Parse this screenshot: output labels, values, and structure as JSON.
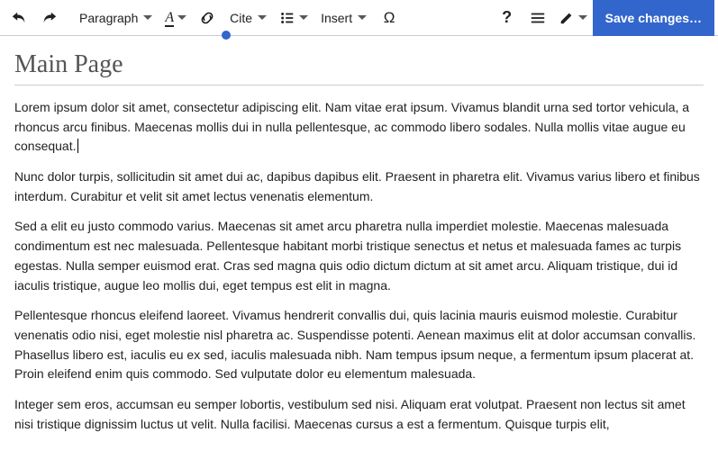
{
  "toolbar": {
    "format_dropdown_label": "Paragraph",
    "cite_label": "Cite",
    "insert_label": "Insert",
    "special_char_label": "Ω",
    "save_label": "Save changes…"
  },
  "page": {
    "title": "Main Page",
    "paragraphs": [
      "Lorem ipsum dolor sit amet, consectetur adipiscing elit. Nam vitae erat ipsum. Vivamus blandit urna sed tortor vehicula, a rhoncus arcu finibus. Maecenas mollis dui in nulla pellentesque, ac commodo libero sodales. Nulla mollis vitae augue eu consequat.",
      "Nunc dolor turpis, sollicitudin sit amet dui ac, dapibus dapibus elit. Praesent in pharetra elit. Vivamus varius libero et finibus interdum. Curabitur et velit sit amet lectus venenatis elementum.",
      "Sed a elit eu justo commodo varius. Maecenas sit amet arcu pharetra nulla imperdiet molestie. Maecenas malesuada condimentum est nec malesuada. Pellentesque habitant morbi tristique senectus et netus et malesuada fames ac turpis egestas. Nulla semper euismod erat. Cras sed magna quis odio dictum dictum at sit amet arcu. Aliquam tristique, dui id iaculis tristique, augue leo mollis dui, eget tempus est elit in magna.",
      "Pellentesque rhoncus eleifend laoreet. Vivamus hendrerit convallis dui, quis lacinia mauris euismod molestie. Curabitur venenatis odio nisi, eget molestie nisl pharetra ac. Suspendisse potenti. Aenean maximus elit at dolor accumsan convallis. Phasellus libero est, iaculis eu ex sed, iaculis malesuada nibh. Nam tempus ipsum neque, a fermentum ipsum placerat at. Proin eleifend enim quis commodo. Sed vulputate dolor eu elementum malesuada.",
      "Integer sem eros, accumsan eu semper lobortis, vestibulum sed nisi. Aliquam erat volutpat. Praesent non lectus sit amet nisi tristique dignissim luctus ut velit. Nulla facilisi. Maecenas cursus a est a fermentum. Quisque turpis elit,"
    ]
  }
}
